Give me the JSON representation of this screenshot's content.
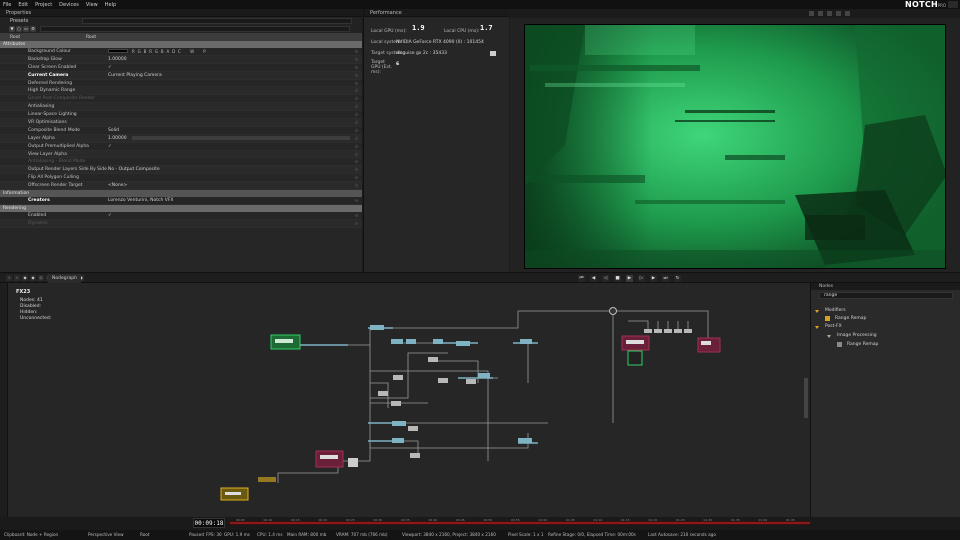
{
  "menu": [
    "File",
    "Edit",
    "Project",
    "Devices",
    "View",
    "Help"
  ],
  "logo": {
    "main": "NOTCH",
    "suffix": "PRO"
  },
  "properties": {
    "tab_label": "Properties",
    "presets_label": "Presets",
    "col_headers": [
      "Root",
      "Root"
    ],
    "sections": {
      "attributes": "Attributes",
      "information": "Information",
      "rendering": "Rendering"
    },
    "rows": [
      {
        "label": "Background Colour",
        "value": "",
        "kind": "colour",
        "rgba": "R G B R G B A D",
        "cwp": "C W P"
      },
      {
        "label": "Backdrop Glow",
        "value": "1.00000"
      },
      {
        "label": "Clear Screen Enabled",
        "value": "✓"
      },
      {
        "label": "Current Camera",
        "value": "Current Playing Camera",
        "bold": true
      },
      {
        "label": "Deferred Rendering",
        "value": ""
      },
      {
        "label": "High Dynamic Range",
        "value": ""
      },
      {
        "label": "Ghost Post-Composite Render",
        "value": "",
        "dim": true
      },
      {
        "label": "Antialiasing",
        "value": ""
      },
      {
        "label": "Linear-Space Lighting",
        "value": ""
      },
      {
        "label": "VR Optimisations",
        "value": ""
      },
      {
        "label": "Composite Blend Mode",
        "value": "Solid"
      },
      {
        "label": "Layer Alpha",
        "value": "1.00000",
        "slider": true
      },
      {
        "label": "Output Premultiplied Alpha",
        "value": "✓"
      },
      {
        "label": "View Layer Alpha",
        "value": ""
      },
      {
        "label": "Antialiasing - Blend Mode",
        "value": "",
        "dim": true
      },
      {
        "label": "Output Render Layers Side By Side",
        "value": "No - Output Composite"
      },
      {
        "label": "Flip All Polygon Culling",
        "value": ""
      },
      {
        "label": "Offscreen Render Target",
        "value": "<None>"
      }
    ],
    "info_rows": [
      {
        "label": "Creators",
        "value": "Lorenzo Venturini, Notch VFX",
        "bold": true
      }
    ],
    "render_rows": [
      {
        "label": "Enabled",
        "value": "✓"
      },
      {
        "label": "Dynamic",
        "value": "",
        "dim": true
      }
    ]
  },
  "performance": {
    "tab_label": "Performance",
    "local_gpu_label": "Local GPU (ms):",
    "local_gpu_value": "1.9",
    "local_cpu_label": "Local CPU (ms):",
    "local_cpu_value": "1.7",
    "local_system_label": "Local system:",
    "local_system_value": "NVIDIA GeForce RTX 4090 (0) : 101454",
    "target_system_label": "Target system:",
    "target_system_value": "disguise gx 2c : 35433",
    "target_gpu_label": "Target GPU (Est. ms):",
    "target_gpu_value": "6"
  },
  "nodegraph": {
    "tab_label": "Nodegraph",
    "layer_name": "FX23",
    "stats": [
      "Nodes: 41",
      "Disabled:",
      "Hidden:",
      "Unconnected:"
    ]
  },
  "nodes_panel": {
    "tab_label": "Nodes",
    "search_value": "range",
    "tree": [
      {
        "label": "Modifiers",
        "depth": 0,
        "kind": "folder"
      },
      {
        "label": "Range Remap",
        "depth": 1,
        "kind": "node",
        "color": "#d6a020"
      },
      {
        "label": "Post-FX",
        "depth": 0,
        "kind": "folder"
      },
      {
        "label": "Image Processing",
        "depth": 1,
        "kind": "folder"
      },
      {
        "label": "Range Remap",
        "depth": 2,
        "kind": "node",
        "color": "#8a8a8a"
      }
    ]
  },
  "timeline": {
    "current_time": "00:09:18",
    "ticks": [
      "00:05",
      "00:10",
      "00:15",
      "00:20",
      "00:25",
      "00:30",
      "00:35",
      "00:40",
      "00:45",
      "00:50",
      "00:55",
      "01:00",
      "01:05",
      "01:10",
      "01:15",
      "01:20",
      "01:25",
      "01:30",
      "01:35",
      "01:40",
      "01:45"
    ]
  },
  "statusbar": {
    "items": [
      "Clipboard: Node + Region",
      "Perspective View",
      "Root",
      "Paused",
      "FPS: 30",
      "GPU: 1.9 ms",
      "CPU: 1.4 ms",
      "Main RAM: 800 mb",
      "VRAM: 707 mb (766 mb)",
      "Viewport: 3840 x 2160, Project: 3840 x 2160",
      "Pixel Scale: 1 x 1",
      "Refine Stage: 0/0, Elapsed Time: 00m:00s",
      "Last Autosave: 210 seconds ago"
    ]
  },
  "colors": {
    "accent_green": "#2fd06a",
    "node_teal": "#7fb3c4",
    "node_red": "#a03050",
    "node_yellow": "#e0b020",
    "timeline_red": "#8a1a1a"
  }
}
